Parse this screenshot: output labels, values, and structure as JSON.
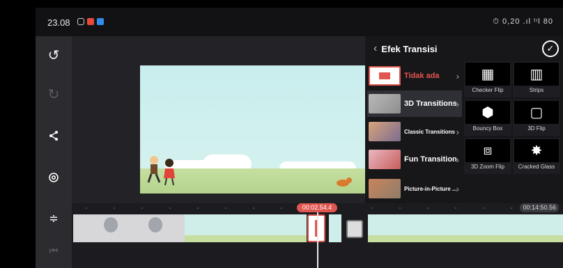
{
  "status": {
    "time": "23.08",
    "right": "⏱ 0,20 .ıl ᵗᶦl 80"
  },
  "toolbar": {
    "undo_icon": "undo-icon",
    "redo_icon": "redo-icon",
    "share_icon": "share-icon",
    "settings_icon": "settings-icon"
  },
  "panel": {
    "title": "Efek Transisi",
    "categories": [
      {
        "label": "Tidak ada"
      },
      {
        "label": "3D Transitions"
      },
      {
        "label": "Classic Transitions"
      },
      {
        "label": "Fun Transitions"
      },
      {
        "label": "Picture-in-Picture ..."
      }
    ],
    "effects": [
      {
        "label": "Checker Flip"
      },
      {
        "label": "Strips"
      },
      {
        "label": "Bouncy Box"
      },
      {
        "label": "3D Flip"
      },
      {
        "label": "3D Zoom Flip"
      },
      {
        "label": "Cracked Glass"
      }
    ]
  },
  "timeline": {
    "playhead_time": "00:02.54.4",
    "end_time": "00:14:50.56"
  },
  "colors": {
    "accent": "#e0554f",
    "panel_bg": "#17171a"
  }
}
